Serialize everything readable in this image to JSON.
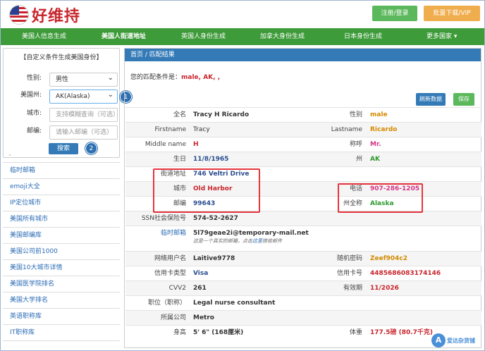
{
  "header": {
    "site_name": "好维持",
    "login_label": "注册/登录",
    "vip_label": "批量下载/VIP"
  },
  "nav": {
    "items": [
      {
        "label": "美国人信息生成"
      },
      {
        "label": "美国人街道地址"
      },
      {
        "label": "英国人身份生成"
      },
      {
        "label": "加拿大身份生成"
      },
      {
        "label": "日本身份生成"
      },
      {
        "label": "更多国家 ▾"
      }
    ]
  },
  "sidebar": {
    "panel_title": "【自定义条件生成美国身份】",
    "gender_label": "性别:",
    "gender_value": "男性",
    "state_label": "美国州:",
    "state_value": "AK(Alaska)",
    "city_label": "城市:",
    "city_placeholder": "支持模糊查询（可选）",
    "zip_label": "邮编:",
    "zip_placeholder": "请输入邮编（可选）",
    "search_label": "搜索",
    "badge1": "1",
    "badge2": "2",
    "caret": "⌃",
    "links": [
      {
        "label": "临时邮箱"
      },
      {
        "label": "emoji大全"
      },
      {
        "label": "IP定位城市"
      },
      {
        "label": "美国所有城市"
      },
      {
        "label": "美国邮编库"
      },
      {
        "label": "美国公司前1000"
      },
      {
        "label": "美国10大城市详情"
      },
      {
        "label": "美国医学院排名"
      },
      {
        "label": "美国大学排名"
      },
      {
        "label": "英语职称库"
      },
      {
        "label": "IT职称库"
      }
    ]
  },
  "main": {
    "breadcrumb": "首页 /  匹配结果",
    "cond_prefix": "您的匹配条件是：",
    "cond_value": "male, AK, ,",
    "refresh_label": "刷新数据",
    "save_label": "保存",
    "rows": {
      "fullname_label": "全名",
      "fullname": "Tracy H Ricardo",
      "gender_label": "性别",
      "gender": "male",
      "firstname_label": "Firstname",
      "firstname": "Tracy",
      "lastname_label": "Lastname",
      "lastname": "Ricardo",
      "middlename_label": "Middle name",
      "middlename": "H",
      "title_label": "称呼",
      "title": "Mr.",
      "birthday_label": "生日",
      "birthday": "11/8/1965",
      "state_label": "州",
      "state": "AK",
      "street_label": "街道地址",
      "street": "746 Veltri Drive",
      "city_label": "城市",
      "city": "Old Harbor",
      "phone_label": "电话",
      "phone": "907-286-1205",
      "zip_label": "邮编",
      "zip": "99643",
      "statefull_label": "州全称",
      "statefull": "Alaska",
      "ssn_label": "SSN社会保险号",
      "ssn": "574-52-2627",
      "email_label": "临时邮箱",
      "email": "5l79geae2i@temporary-mail.net",
      "email_note_a": "这是一个真实的邮箱，点击",
      "email_note_link": "这里",
      "email_note_b": "接收邮件",
      "username_label": "网络用户名",
      "username": "Laitive9778",
      "password_label": "随机密码",
      "password": "Zeef904c2",
      "cardtype_label": "信用卡类型",
      "cardtype": "Visa",
      "cardnum_label": "信用卡号",
      "cardnum": "4485686083174146",
      "cvv_label": "CVV2",
      "cvv": "261",
      "expiry_label": "有效期",
      "expiry": "11/2026",
      "job_label": "职位（职称）",
      "job": "Legal nurse consultant",
      "company_label": "所属公司",
      "company": "Metro",
      "height_label": "身高",
      "height": "5' 6\"   (168厘米)",
      "weight_label": "体重",
      "weight": "177.5磅 (80.7千克)"
    }
  },
  "watermark": {
    "icon": "A",
    "text": "爱达杂货铺"
  },
  "colors": {
    "nav": "#3e9b3a",
    "primary": "#337ab7",
    "success": "#5cb85c",
    "warning": "#f0ad4e",
    "highlight": "#e5343d"
  }
}
